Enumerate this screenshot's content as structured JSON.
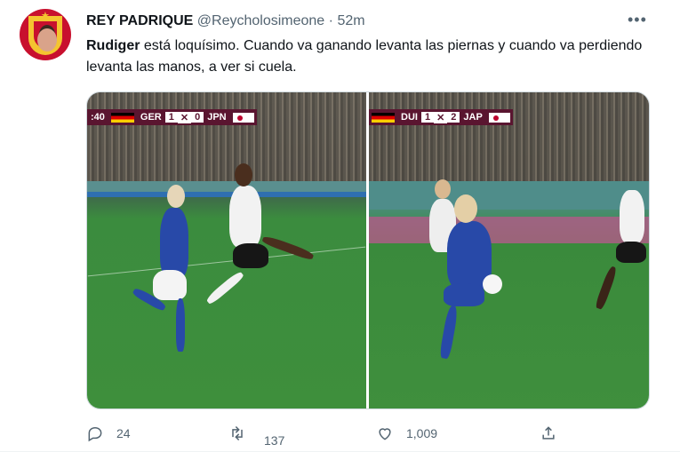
{
  "tweet": {
    "display_name": "REY PADRIQUE",
    "handle": "@Reycholosimeone",
    "separator": "·",
    "time": "52m",
    "more_label": "•••",
    "text_bold": "Rudiger",
    "text_rest": " está loquísimo. Cuando va ganando levanta las piernas y cuando va perdiendo levanta las manos, a ver si cuela."
  },
  "media": {
    "left_score": {
      "clock": ":40",
      "home": "GER",
      "home_goals": "1",
      "away_goals": "0",
      "away": "JPN"
    },
    "right_score": {
      "home": "DUI",
      "home_goals": "1",
      "away_goals": "2",
      "away": "JAP"
    }
  },
  "actions": {
    "reply_count": "24",
    "retweet_count": "137",
    "like_count": "1,009"
  },
  "icons": {
    "reply": "reply-icon",
    "retweet": "retweet-icon",
    "like": "like-icon",
    "share": "share-icon",
    "more": "more-icon"
  },
  "colors": {
    "text": "#0f1419",
    "secondary": "#536471",
    "border": "#cfd9de",
    "scoreboard": "#5a1530"
  }
}
